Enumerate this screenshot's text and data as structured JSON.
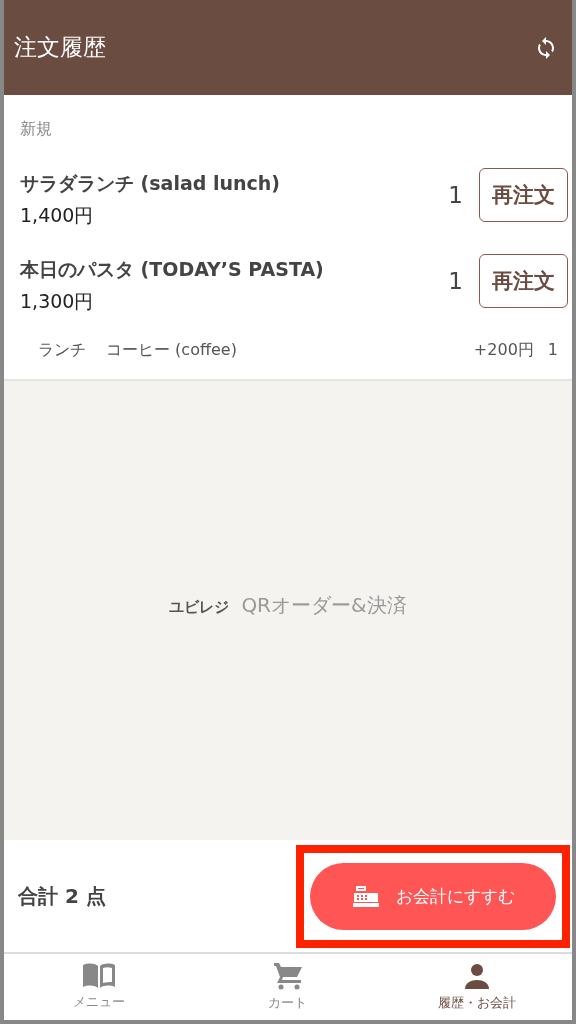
{
  "header": {
    "title": "注文履歴"
  },
  "section": {
    "label": "新規"
  },
  "items": [
    {
      "name": "サラダランチ (salad lunch)",
      "price": "1,400円",
      "quantity": "1",
      "button": "再注文"
    },
    {
      "name": "本日のパスタ (TODAY’S PASTA)",
      "price": "1,300円",
      "quantity": "1",
      "button": "再注文",
      "options": [
        {
          "group": "ランチ",
          "name": "コーヒー (coffee)",
          "price": "+200円",
          "quantity": "1"
        }
      ]
    }
  ],
  "brand": {
    "name": "ユビレジ",
    "tagline": "QRオーダー&決済"
  },
  "footer": {
    "total": "合計 2 点",
    "checkout": {
      "label": "お会計にすすむ",
      "highlighted": true
    }
  },
  "nav": [
    {
      "kind": "book",
      "label": "メニュー",
      "selected": false
    },
    {
      "kind": "cart",
      "label": "カート",
      "selected": false
    },
    {
      "kind": "person",
      "label": "履歴・お会計",
      "selected": true
    }
  ]
}
